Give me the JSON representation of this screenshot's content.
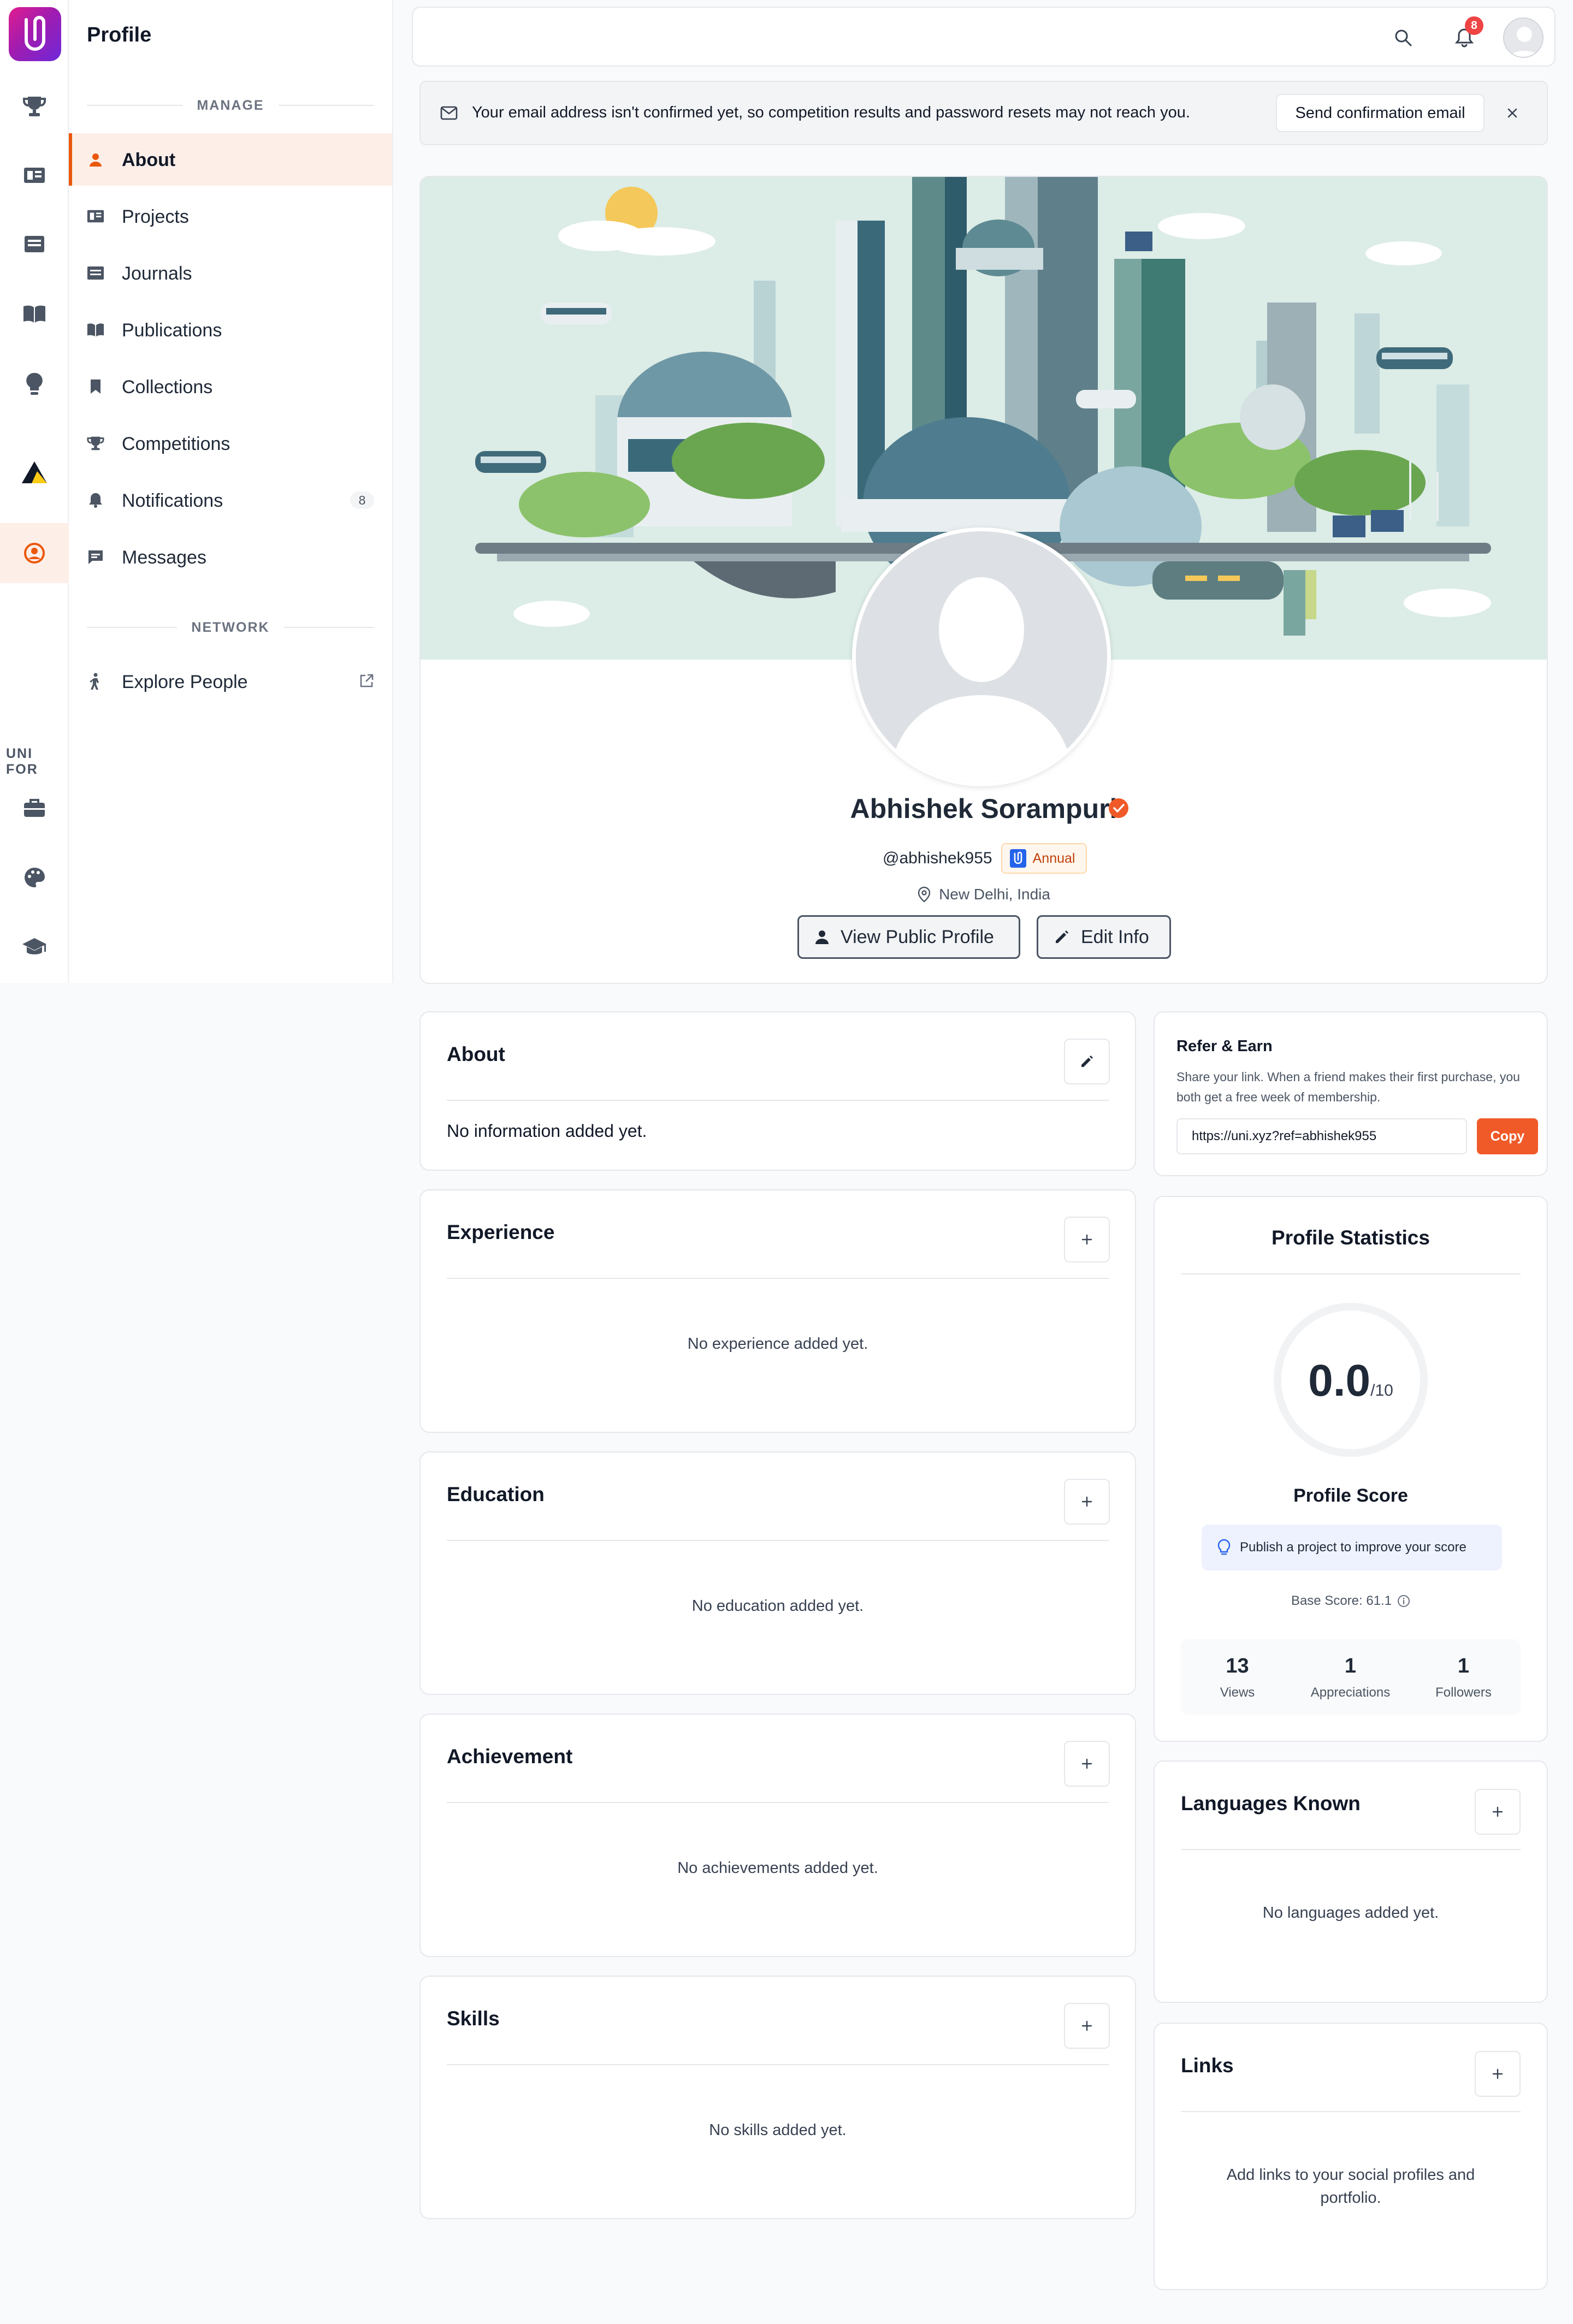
{
  "sidebar": {
    "section_label": "UNI FOR",
    "nav": {
      "title": "Profile",
      "manage_label": "MANAGE",
      "network_label": "NETWORK"
    },
    "items": [
      {
        "label": "About",
        "icon": "person-icon",
        "active": true
      },
      {
        "label": "Projects",
        "icon": "projects-icon"
      },
      {
        "label": "Journals",
        "icon": "journal-icon"
      },
      {
        "label": "Publications",
        "icon": "book-icon"
      },
      {
        "label": "Collections",
        "icon": "bookmark-icon"
      },
      {
        "label": "Competitions",
        "icon": "trophy-icon"
      },
      {
        "label": "Notifications",
        "icon": "bell-icon",
        "badge": "8"
      },
      {
        "label": "Messages",
        "icon": "message-icon"
      }
    ],
    "network_items": [
      {
        "label": "Explore People",
        "icon": "explore-icon"
      }
    ]
  },
  "topbar": {
    "notification_count": "8"
  },
  "alert": {
    "text": "Your email address isn't confirmed yet, so competition results and password resets may not reach you.",
    "button": "Send confirmation email"
  },
  "profile": {
    "name": "Abhishek Sorampuri",
    "username": "@abhishek955",
    "plan": "Annual",
    "location": "New Delhi, India",
    "view_public": "View Public Profile",
    "edit_info": "Edit Info"
  },
  "sections": {
    "about": {
      "title": "About",
      "empty": "No information added yet."
    },
    "experience": {
      "title": "Experience",
      "empty": "No experience added yet."
    },
    "education": {
      "title": "Education",
      "empty": "No education added yet."
    },
    "achievement": {
      "title": "Achievement",
      "empty": "No achievements added yet."
    },
    "skills": {
      "title": "Skills",
      "empty": "No skills added yet."
    },
    "languages": {
      "title": "Languages Known",
      "empty": "No languages added yet."
    },
    "links": {
      "title": "Links",
      "empty": "Add links to your social profiles and portfolio."
    }
  },
  "refer": {
    "title": "Refer & Earn",
    "description": "Share your link. When a friend makes their first purchase, you both get a free week of membership.",
    "link": "https://uni.xyz?ref=abhishek955",
    "copy": "Copy"
  },
  "stats": {
    "title": "Profile Statistics",
    "score": "0.0",
    "score_max": "/10",
    "score_label": "Profile Score",
    "tip": "Publish a project to improve your score",
    "base_score": "Base Score: 61.1",
    "items": [
      {
        "value": "13",
        "label": "Views"
      },
      {
        "value": "1",
        "label": "Appreciations"
      },
      {
        "value": "1",
        "label": "Followers"
      }
    ]
  },
  "colors": {
    "accent": "#f05a28",
    "active_bg": "#fdeee8",
    "badge_red": "#ef4444"
  }
}
